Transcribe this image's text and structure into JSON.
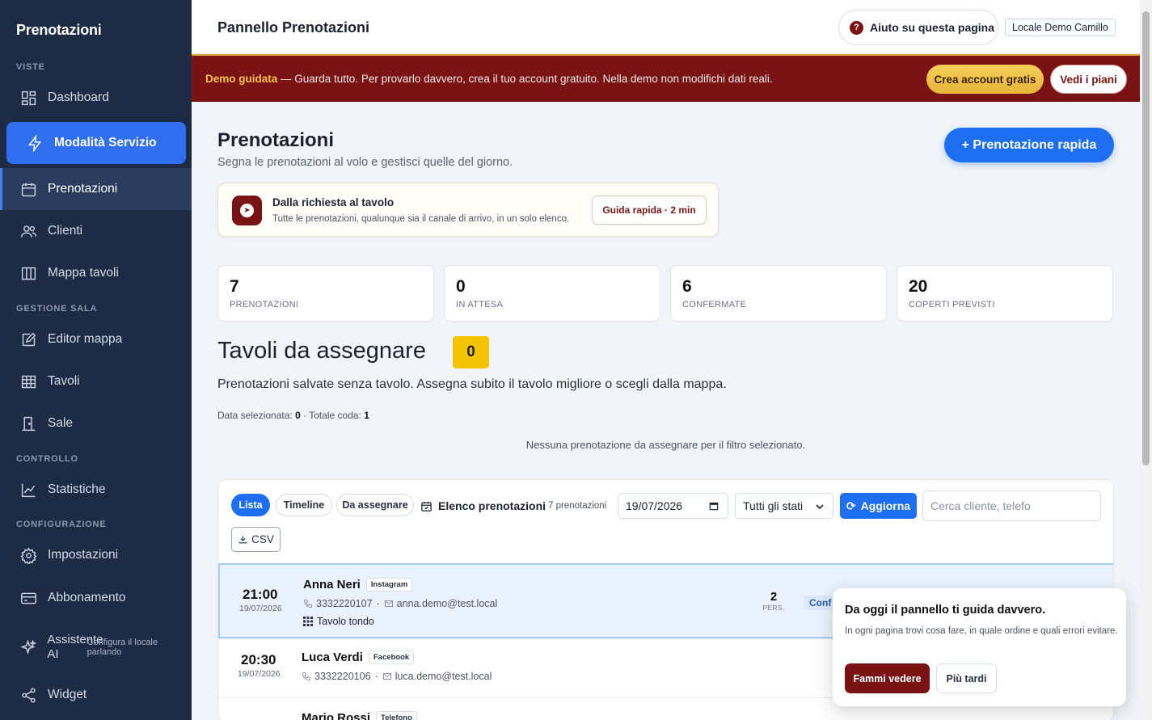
{
  "sidebar": {
    "brand": "Prenotazioni",
    "sections": {
      "viste": "VISTE",
      "gestione_sala": "GESTIONE SALA",
      "controllo": "CONTROLLO",
      "configurazione": "CONFIGURAZIONE"
    },
    "items": {
      "dashboard": "Dashboard",
      "service_mode": "Modalità Servizio",
      "bookings": "Prenotazioni",
      "clients": "Clienti",
      "table_map": "Mappa tavoli",
      "map_editor": "Editor mappa",
      "tables": "Tavoli",
      "rooms": "Sale",
      "stats": "Statistiche",
      "settings": "Impostazioni",
      "subscription": "Abbonamento",
      "ai_assistant": "Assistente AI",
      "ai_assistant_sub": "Configura il locale parlando",
      "widget": "Widget"
    }
  },
  "header": {
    "title": "Pannello Prenotazioni",
    "help": "Aiuto su questa pagina",
    "venue": "Locale Demo Camillo"
  },
  "banner": {
    "lead": "Demo guidata",
    "text": " — Guarda tutto. Per provarlo davvero, crea il tuo account gratuito. Nella demo non modifichi dati reali.",
    "cta_primary": "Crea account gratis",
    "cta_secondary": "Vedi i piani"
  },
  "page": {
    "title": "Prenotazioni",
    "subtitle": "Segna le prenotazioni al volo e gestisci quelle del giorno.",
    "quick_button": "+ Prenotazione rapida"
  },
  "guide": {
    "title": "Dalla richiesta al tavolo",
    "subtitle": "Tutte le prenotazioni, qualunque sia il canale di arrivo, in un solo elenco.",
    "button": "Guida rapida · 2 min"
  },
  "stats": [
    {
      "value": "7",
      "label": "PRENOTAZIONI"
    },
    {
      "value": "0",
      "label": "IN ATTESA"
    },
    {
      "value": "6",
      "label": "CONFERMATE"
    },
    {
      "value": "20",
      "label": "COPERTI PREVISTI"
    }
  ],
  "unassigned": {
    "title": "Tavoli da assegnare",
    "count": "0",
    "description": "Prenotazioni salvate senza tavolo. Assegna subito il tavolo migliore o scegli dalla mappa.",
    "meta_label1": "Data selezionata: ",
    "meta_value1": "0",
    "meta_label2": " · Totale coda: ",
    "meta_value2": "1",
    "empty": "Nessuna prenotazione da assegnare per il filtro selezionato."
  },
  "list": {
    "tabs": [
      "Lista",
      "Timeline",
      "Da assegnare"
    ],
    "title": "Elenco prenotazioni",
    "count": "7 prenotazioni",
    "date": "19/07/2026",
    "status_filter": "Tutti gli stati",
    "refresh": "Aggiorna",
    "search_placeholder": "Cerca cliente, telefo",
    "csv": "CSV",
    "rows": [
      {
        "time": "21:00",
        "date": "19/07/2026",
        "name": "Anna Neri",
        "source": "Instagram",
        "phone": "3332220107",
        "email": "anna.demo@test.local",
        "table": "Tavolo tondo",
        "pax": "2",
        "pax_label": "PERS.",
        "status": "Conf"
      },
      {
        "time": "20:30",
        "date": "19/07/2026",
        "name": "Luca Verdi",
        "source": "Facebook",
        "phone": "3332220106",
        "email": "luca.demo@test.local",
        "table": "",
        "pax": "",
        "pax_label": "",
        "status": ""
      },
      {
        "time": "",
        "date": "",
        "name": "Mario Rossi",
        "source": "Telefono",
        "phone": "",
        "email": "",
        "table": "",
        "pax": "",
        "pax_label": "",
        "status": ""
      }
    ]
  },
  "popover": {
    "title": "Da oggi il pannello ti guida davvero.",
    "text": "In ogni pagina trovi cosa fare, in quale ordine e quali errori evitare.",
    "primary": "Fammi vedere",
    "secondary": "Più tardi"
  },
  "colors": {
    "sidebar_bg": "#1d2b45",
    "accent_blue": "#1d6ef0",
    "brand_red": "#7a1414",
    "gold": "#f5c400"
  }
}
